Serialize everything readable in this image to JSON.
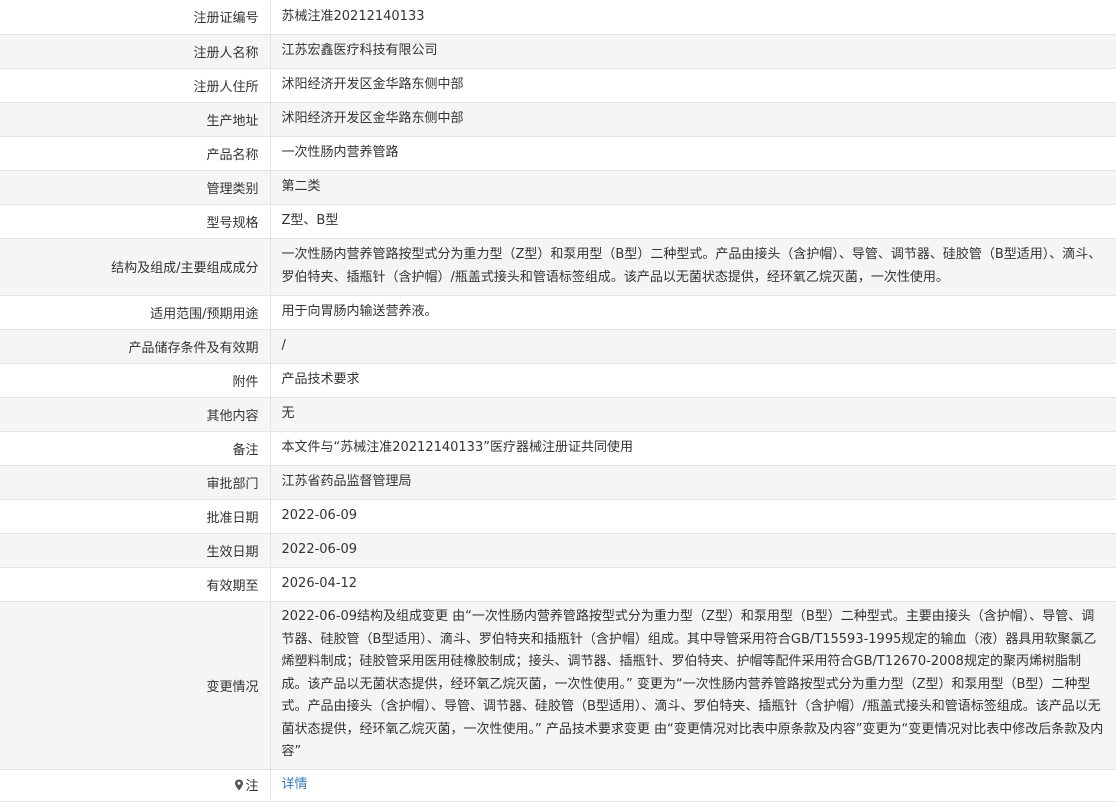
{
  "rows": [
    {
      "label": "注册证编号",
      "value": "苏械注准20212140133"
    },
    {
      "label": "注册人名称",
      "value": "江苏宏鑫医疗科技有限公司"
    },
    {
      "label": "注册人住所",
      "value": "沭阳经济开发区金华路东侧中部"
    },
    {
      "label": "生产地址",
      "value": "沭阳经济开发区金华路东侧中部"
    },
    {
      "label": "产品名称",
      "value": "一次性肠内营养管路"
    },
    {
      "label": "管理类别",
      "value": "第二类"
    },
    {
      "label": "型号规格",
      "value": "Z型、B型"
    },
    {
      "label": "结构及组成/主要组成成分",
      "value": "一次性肠内营养管路按型式分为重力型（Z型）和泵用型（B型）二种型式。产品由接头（含护帽）、导管、调节器、硅胶管（B型适用）、滴斗、罗伯特夹、插瓶针（含护帽）/瓶盖式接头和管语标签组成。该产品以无菌状态提供，经环氧乙烷灭菌，一次性使用。"
    },
    {
      "label": "适用范围/预期用途",
      "value": "用于向胃肠内输送营养液。"
    },
    {
      "label": "产品储存条件及有效期",
      "value": "/"
    },
    {
      "label": "附件",
      "value": "产品技术要求"
    },
    {
      "label": "其他内容",
      "value": "无"
    },
    {
      "label": "备注",
      "value": "本文件与“苏械注准20212140133”医疗器械注册证共同使用"
    },
    {
      "label": "审批部门",
      "value": "江苏省药品监督管理局"
    },
    {
      "label": "批准日期",
      "value": "2022-06-09"
    },
    {
      "label": "生效日期",
      "value": "2022-06-09"
    },
    {
      "label": "有效期至",
      "value": "2026-04-12"
    },
    {
      "label": "变更情况",
      "value": "2022-06-09结构及组成变更 由“一次性肠内营养管路按型式分为重力型（Z型）和泵用型（B型）二种型式。主要由接头（含护帽）、导管、调节器、硅胶管（B型适用）、滴斗、罗伯特夹和插瓶针（含护帽）组成。其中导管采用符合GB/T15593-1995规定的输血（液）器具用软聚氯乙烯塑料制成；硅胶管采用医用硅橡胶制成；接头、调节器、插瓶针、罗伯特夹、护帽等配件采用符合GB/T12670-2008规定的聚丙烯树脂制成。该产品以无菌状态提供，经环氧乙烷灭菌，一次性使用。” 变更为“一次性肠内营养管路按型式分为重力型（Z型）和泵用型（B型）二种型式。产品由接头（含护帽）、导管、调节器、硅胶管（B型适用）、滴斗、罗伯特夹、插瓶针（含护帽）/瓶盖式接头和管语标签组成。该产品以无菌状态提供，经环氧乙烷灭菌，一次性使用。” 产品技术要求变更 由“变更情况对比表中原条款及内容”变更为“变更情况对比表中修改后条款及内容”"
    }
  ],
  "note": {
    "label": "注",
    "icon": "map-pin-icon",
    "link_text": "详情"
  },
  "colors": {
    "link": "#3a78c3",
    "alt_row": "#f5f5f5",
    "border": "#e4e4e4"
  }
}
